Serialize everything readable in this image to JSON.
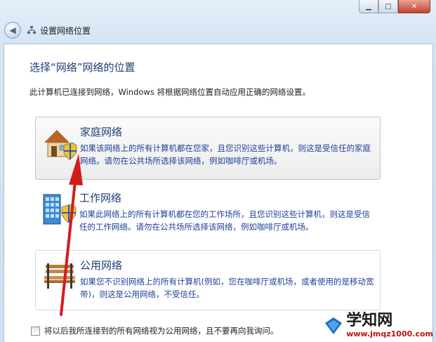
{
  "window": {
    "title": "设置网络位置",
    "back_icon": "back-arrow-icon",
    "caption_buttons": [
      "minimize",
      "maximize",
      "close"
    ],
    "accent": "#1f3f78"
  },
  "content": {
    "heading": "选择“网络”网络的位置",
    "description": "此计算机已连接到网络，Windows 将根据网络位置自动应用正确的网络设置。",
    "options": [
      {
        "title": "家庭网络",
        "text": "如果该网络上的所有计算机都在您家，且您识别这些计算机，则这是受信任的家庭网络。请勿在公共场所选择该网络，例如咖啡厅或机场。",
        "icon": "home-network-icon"
      },
      {
        "title": "工作网络",
        "text": "如果此网络上的所有计算机都在您的工作场所，且您识别这些计算机，则这是受信任的工作网络。请勿在公共场所选择该网络，例如咖啡厅或机场。",
        "icon": "work-network-icon"
      },
      {
        "title": "公用网络",
        "text": "如果您不识别网络上的所有计算机(例如，您在咖啡厅或机场，或者使用的是移动宽带)，则这是公用网络，不受信任。",
        "icon": "public-network-icon"
      }
    ],
    "checkbox_label": "将以后我所连接到的所有网络视为公用网络，且不要再向我询问。",
    "checkbox_checked": false
  },
  "watermark": {
    "name": "学知网",
    "url": "www.jmqz1000.com"
  },
  "annotation": {
    "color": "#d21c1c"
  }
}
